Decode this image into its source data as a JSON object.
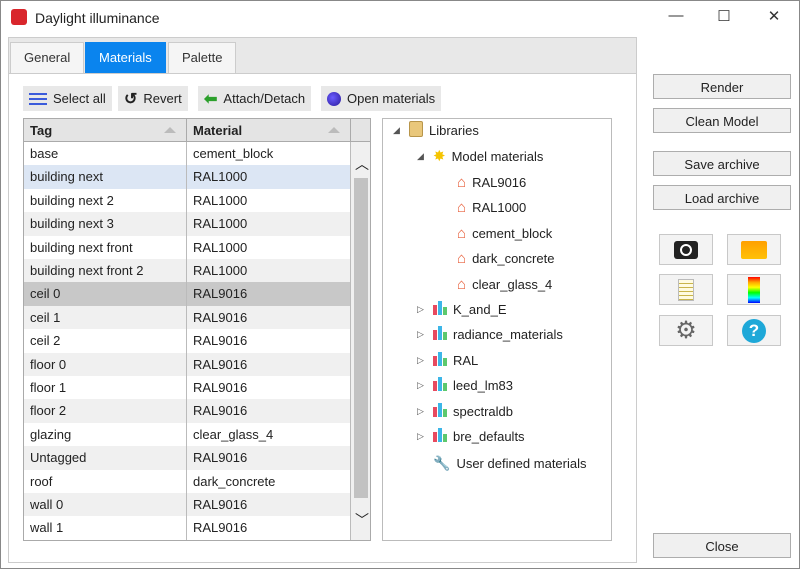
{
  "window": {
    "title": "Daylight illuminance",
    "minimize": "—",
    "maximize": "☐",
    "close": "✕"
  },
  "tabs": [
    {
      "label": "General"
    },
    {
      "label": "Materials",
      "active": true
    },
    {
      "label": "Palette"
    }
  ],
  "toolbar": {
    "select_all": "Select all",
    "revert": "Revert",
    "attach_detach": "Attach/Detach",
    "open_materials": "Open materials"
  },
  "table": {
    "columns": [
      "Tag",
      "Material"
    ],
    "rows": [
      [
        "base",
        "cement_block"
      ],
      [
        "building next",
        "RAL1000"
      ],
      [
        "building next 2",
        "RAL1000"
      ],
      [
        "building next 3",
        "RAL1000"
      ],
      [
        "building next front",
        "RAL1000"
      ],
      [
        "building next front 2",
        "RAL1000"
      ],
      [
        "ceil 0",
        "RAL9016"
      ],
      [
        "ceil 1",
        "RAL9016"
      ],
      [
        "ceil 2",
        "RAL9016"
      ],
      [
        "floor 0",
        "RAL9016"
      ],
      [
        "floor 1",
        "RAL9016"
      ],
      [
        "floor 2",
        "RAL9016"
      ],
      [
        "glazing",
        "clear_glass_4"
      ],
      [
        "Untagged",
        "RAL9016"
      ],
      [
        "roof",
        "dark_concrete"
      ],
      [
        "wall 0",
        "RAL9016"
      ],
      [
        "wall 1",
        "RAL9016"
      ]
    ],
    "selected_rows": [
      1,
      6
    ]
  },
  "tree": {
    "root": "Libraries",
    "model": "Model materials",
    "model_items": [
      "RAL9016",
      "RAL1000",
      "cement_block",
      "dark_concrete",
      "clear_glass_4"
    ],
    "libraries": [
      "K_and_E",
      "radiance_materials",
      "RAL",
      "leed_lm83",
      "spectraldb",
      "bre_defaults"
    ],
    "user": "User defined materials"
  },
  "buttons": {
    "render": "Render",
    "clean": "Clean Model",
    "save": "Save archive",
    "load": "Load archive",
    "close": "Close"
  },
  "colors": {
    "accent": "#0a84ee",
    "selected_row": "#dce6f4"
  }
}
